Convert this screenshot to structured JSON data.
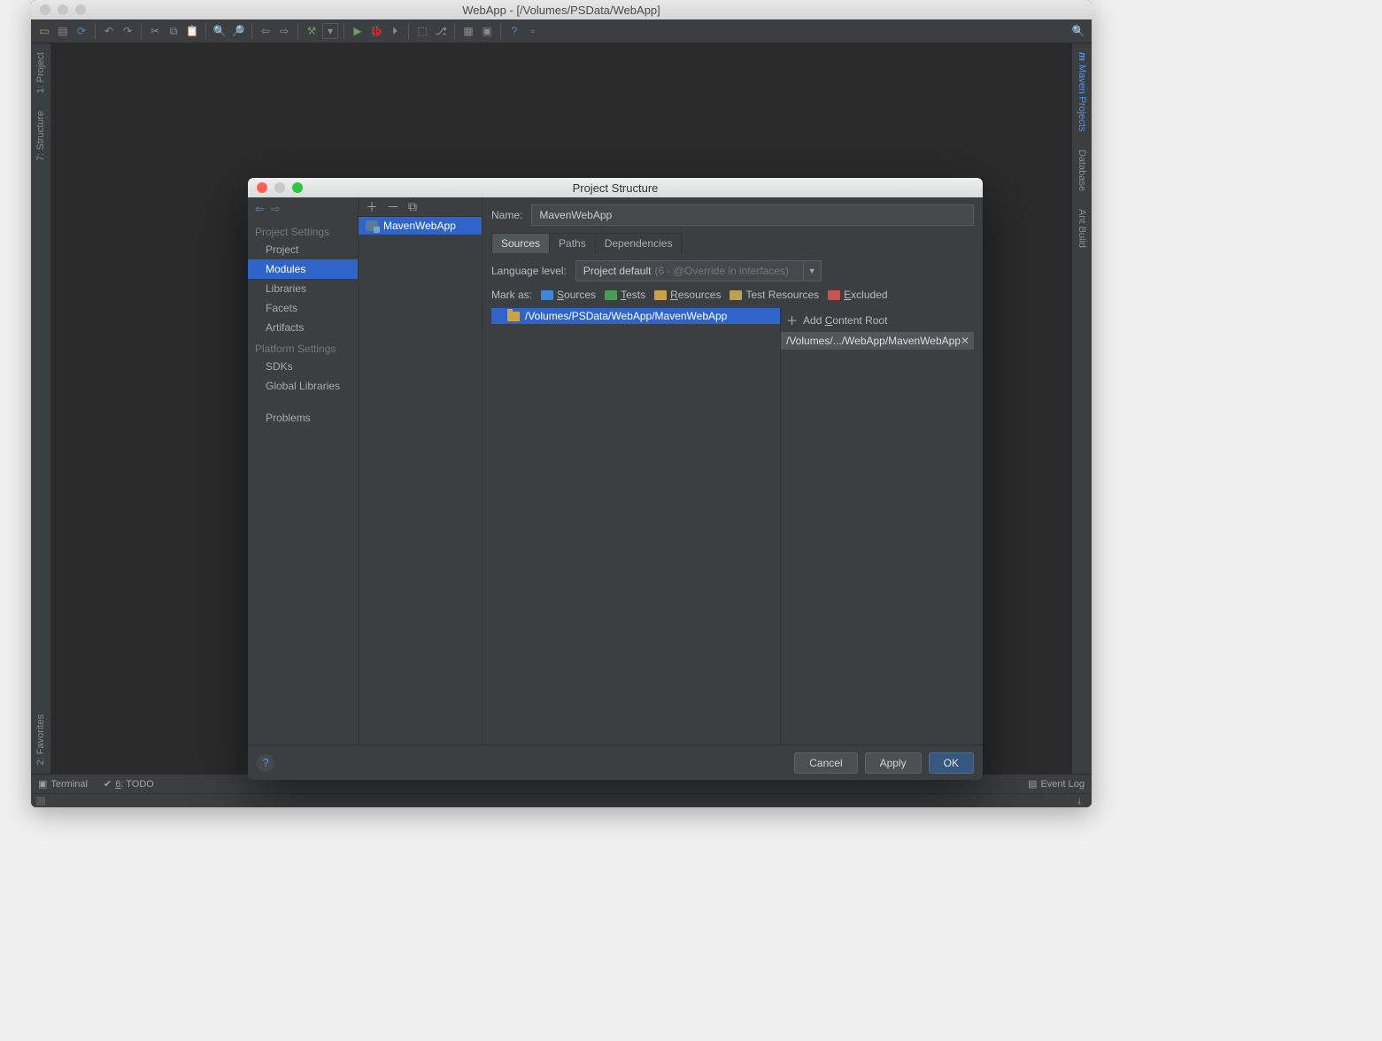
{
  "window": {
    "title": "WebApp - [/Volumes/PSData/WebApp]"
  },
  "left_gutter": {
    "project": "1: Project",
    "structure": "7: Structure"
  },
  "right_gutter": {
    "maven": "Maven Projects",
    "database": "Database",
    "ant": "Ant Build"
  },
  "bottom": {
    "terminal": "Terminal",
    "todo": "6: TODO",
    "event_log": "Event Log"
  },
  "favorites": "2: Favorites",
  "dialog": {
    "title": "Project Structure",
    "sections": {
      "project_settings": "Project Settings",
      "platform_settings": "Platform Settings"
    },
    "items": {
      "project": "Project",
      "modules": "Modules",
      "libraries": "Libraries",
      "facets": "Facets",
      "artifacts": "Artifacts",
      "sdks": "SDKs",
      "global_libraries": "Global Libraries",
      "problems": "Problems"
    },
    "module_list": {
      "item0": "MavenWebApp"
    },
    "name_label": "Name:",
    "name_value": "MavenWebApp",
    "tabs": {
      "sources": "Sources",
      "paths": "Paths",
      "dependencies": "Dependencies"
    },
    "lang_label": "Language level:",
    "lang_value": "Project default",
    "lang_hint": "(6 - @Override in interfaces)",
    "mark_label": "Mark as:",
    "marks": {
      "sources": "Sources",
      "tests": "Tests",
      "resources": "Resources",
      "test_resources": "Test Resources",
      "excluded": "Excluded"
    },
    "tree": {
      "root": "/Volumes/PSData/WebApp/MavenWebApp"
    },
    "content_root": {
      "add": "Add Content Root",
      "path": "/Volumes/.../WebApp/MavenWebApp"
    },
    "buttons": {
      "cancel": "Cancel",
      "apply": "Apply",
      "ok": "OK"
    }
  }
}
